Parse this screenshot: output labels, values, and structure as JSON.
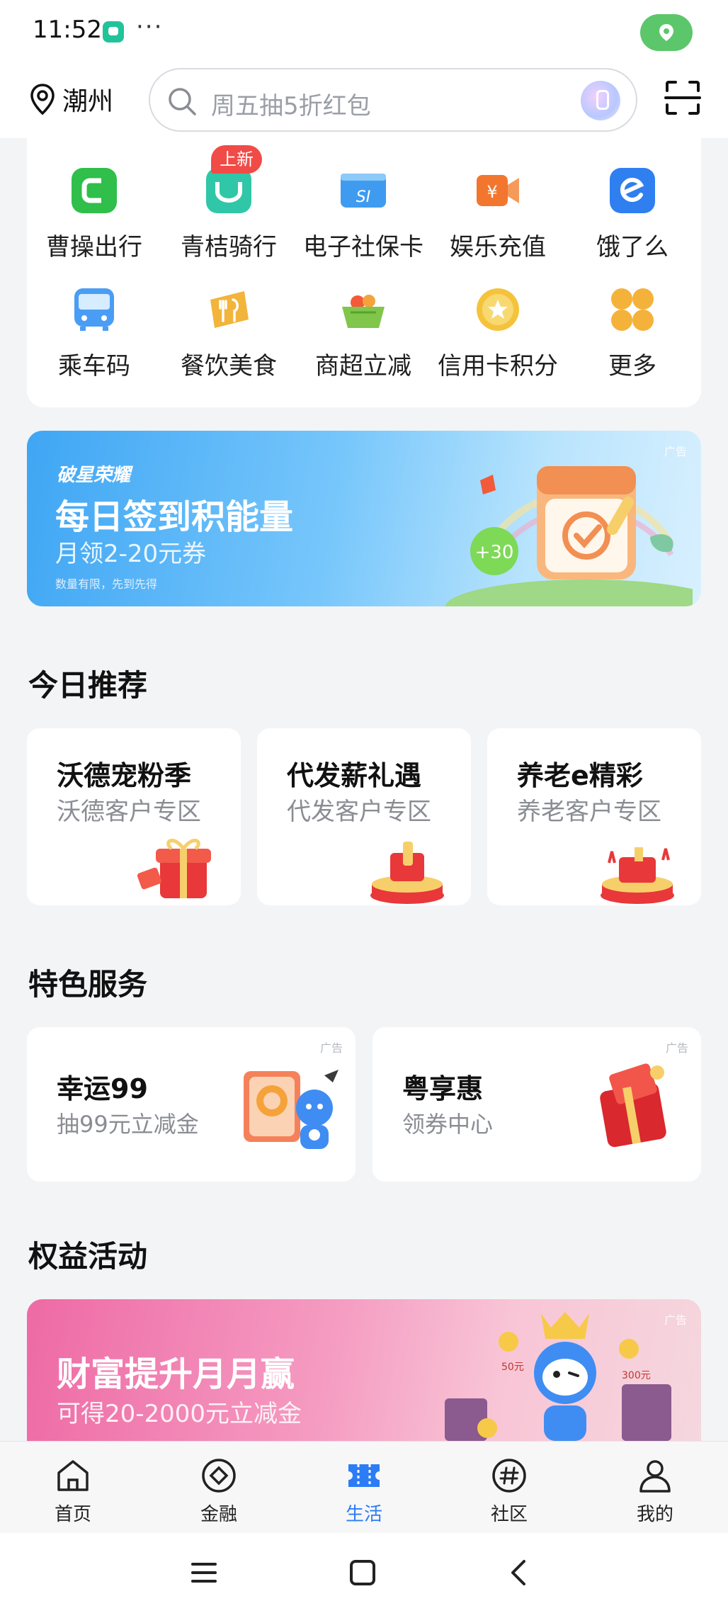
{
  "status_bar": {
    "time": "11:52",
    "dots": "···",
    "icons": [
      "app-notification-icon",
      "location-pill-icon"
    ]
  },
  "header": {
    "city": "潮州",
    "search_placeholder": "周五抽5折红包",
    "icons": [
      "location-pin-icon",
      "search-icon",
      "voice-icon",
      "scan-icon"
    ]
  },
  "services": {
    "new_badge": "上新",
    "items": [
      {
        "label": "曹操出行",
        "icon": "caocao-icon",
        "color": "#2fbf4a"
      },
      {
        "label": "青桔骑行",
        "icon": "qingju-icon",
        "color": "#2fc7a8"
      },
      {
        "label": "电子社保卡",
        "icon": "social-security-card-icon",
        "color": "#3e9bf0"
      },
      {
        "label": "娱乐充值",
        "icon": "entertainment-topup-icon",
        "color": "#f2762e"
      },
      {
        "label": "饿了么",
        "icon": "eleme-icon",
        "color": "#2f7ff0"
      },
      {
        "label": "乘车码",
        "icon": "bus-code-icon",
        "color": "#4a9df4"
      },
      {
        "label": "餐饮美食",
        "icon": "food-icon",
        "color": "#f2b43a"
      },
      {
        "label": "商超立减",
        "icon": "supermarket-basket-icon",
        "color": "#7fc64a"
      },
      {
        "label": "信用卡积分",
        "icon": "credit-points-icon",
        "color": "#f5c33b"
      },
      {
        "label": "更多",
        "icon": "more-grid-icon",
        "color": "#f5b23a"
      }
    ]
  },
  "banner1": {
    "brand": "破星荣耀",
    "title": "每日签到积能量",
    "subtitle": "月领2-20元券",
    "note": "数量有限，先到先得",
    "ad": "广告",
    "badge": "+30"
  },
  "sections": {
    "recommend": "今日推荐",
    "features": "特色服务",
    "benefits": "权益活动"
  },
  "recommend": [
    {
      "title": "沃德宠粉季",
      "subtitle": "沃德客户专区"
    },
    {
      "title": "代发薪礼遇",
      "subtitle": "代发客户专区"
    },
    {
      "title": "养老e精彩",
      "subtitle": "养老客户专区"
    }
  ],
  "features": [
    {
      "title": "幸运99",
      "subtitle": "抽99元立减金",
      "ad": "广告"
    },
    {
      "title": "粤享惠",
      "subtitle": "领券中心",
      "ad": "广告"
    }
  ],
  "banner2": {
    "title": "财富提升月月赢",
    "subtitle": "可得20-2000元立减金",
    "ad": "广告",
    "coin_labels": [
      "50元",
      "300元"
    ]
  },
  "tabs": [
    {
      "label": "首页",
      "icon": "home-icon",
      "active": false
    },
    {
      "label": "金融",
      "icon": "finance-icon",
      "active": false
    },
    {
      "label": "生活",
      "icon": "life-ticket-icon",
      "active": true
    },
    {
      "label": "社区",
      "icon": "community-hash-icon",
      "active": false
    },
    {
      "label": "我的",
      "icon": "profile-icon",
      "active": false
    }
  ],
  "colors": {
    "accent": "#2c7cf6",
    "page_bg": "#f3f4f6",
    "badge_red": "#f04b47"
  }
}
